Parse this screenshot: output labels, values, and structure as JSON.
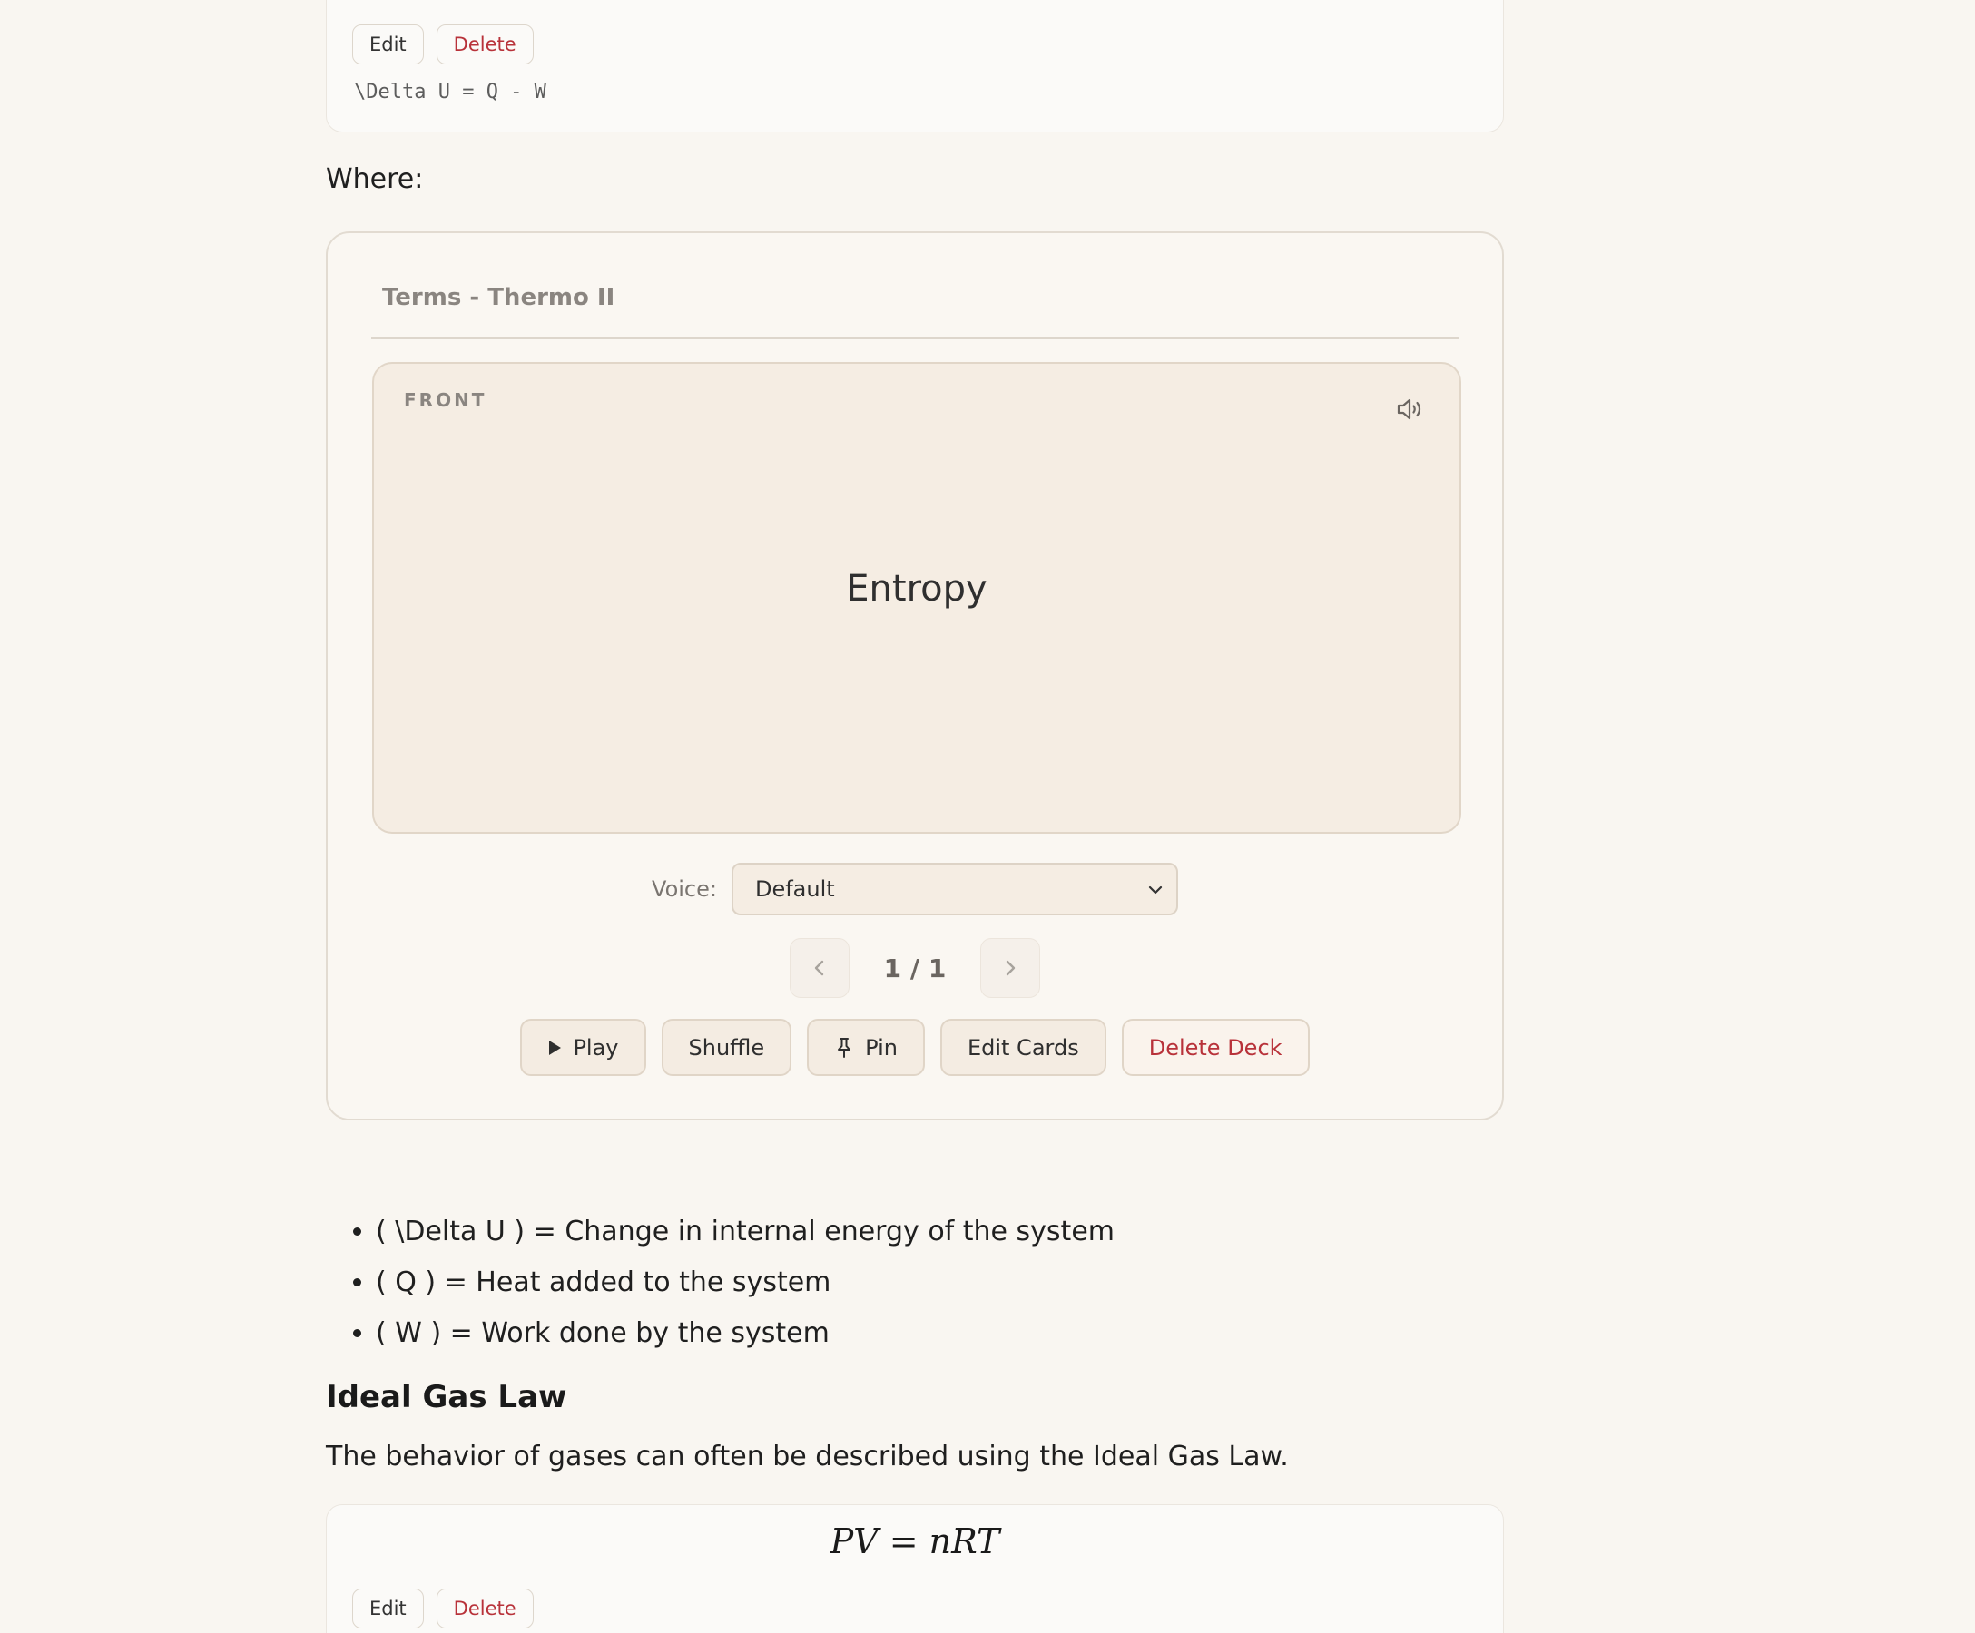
{
  "formula_top": {
    "edit_label": "Edit",
    "delete_label": "Delete",
    "latex_source": "\\Delta U = Q - W"
  },
  "where_text": "Where:",
  "deck": {
    "title": "Terms - Thermo II",
    "card": {
      "side_label": "FRONT",
      "term": "Entropy",
      "speaker_icon": "speaker-icon"
    },
    "voice": {
      "label": "Voice:",
      "selected": "Default"
    },
    "pager": {
      "count": "1 / 1"
    },
    "actions": {
      "play": "Play",
      "shuffle": "Shuffle",
      "pin": "Pin",
      "edit_cards": "Edit Cards",
      "delete_deck": "Delete Deck"
    }
  },
  "definitions": [
    "( \\Delta U ) = Change in internal energy of the system",
    "( Q ) = Heat added to the system",
    "( W ) = Work done by the system"
  ],
  "ideal_gas": {
    "heading": "Ideal Gas Law",
    "paragraph": "The behavior of gases can often be described using the Ideal Gas Law.",
    "formula_rendered": "PV = nRT",
    "edit_label": "Edit",
    "delete_label": "Delete"
  },
  "colors": {
    "background": "#f9f6f1",
    "card": "#f5ede3",
    "danger": "#b8323a",
    "muted": "#8a8580"
  }
}
